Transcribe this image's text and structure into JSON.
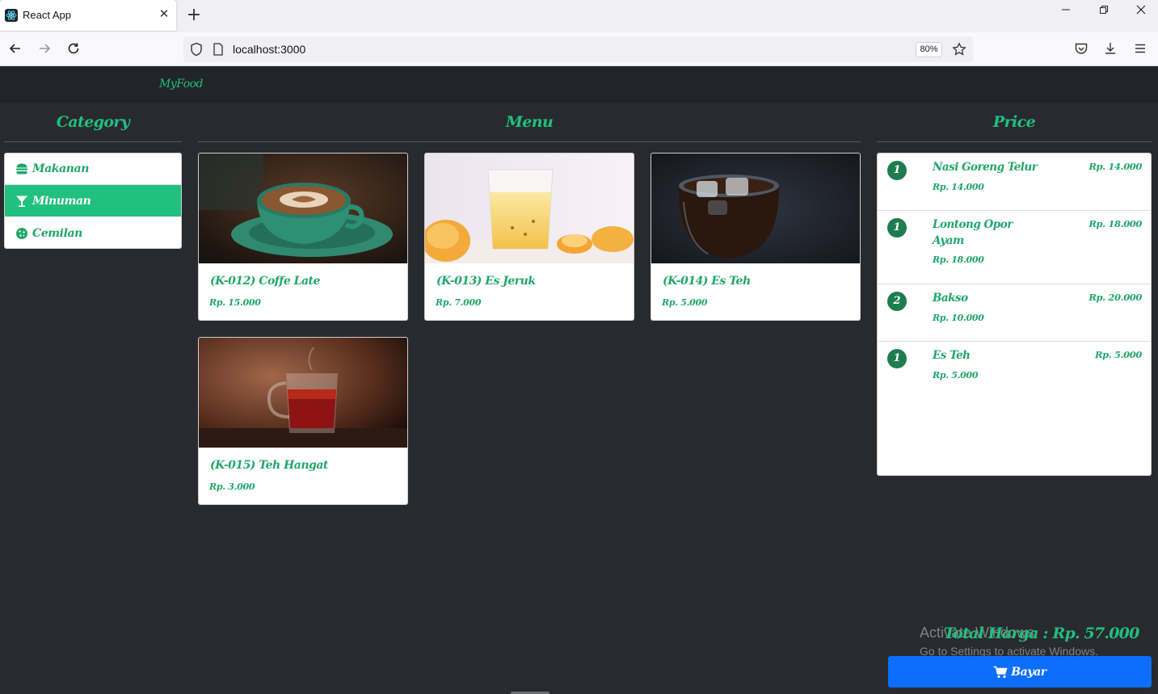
{
  "browser": {
    "tab_title": "React App",
    "tab_close": "✕",
    "new_tab": "+",
    "url": "localhost:3000",
    "zoom": "80%",
    "icons": [
      "react-favicon",
      "back-icon",
      "forward-icon",
      "reload-icon",
      "shield-icon",
      "page-icon",
      "bookmark-star-icon",
      "pocket-icon",
      "download-icon",
      "menu-icon",
      "minimize-icon",
      "restore-icon",
      "close-window-icon"
    ]
  },
  "app": {
    "brand": "MyFood",
    "columns": {
      "category": "Category",
      "menu": "Menu",
      "price": "Price"
    },
    "categories": [
      {
        "label": "Makanan",
        "icon": "burger-icon",
        "active": false
      },
      {
        "label": "Minuman",
        "icon": "cocktail-icon",
        "active": true
      },
      {
        "label": "Cemilan",
        "icon": "cookie-icon",
        "active": false
      }
    ],
    "menu_items": [
      {
        "title": "(K-012) Coffe Late",
        "price": "Rp. 15.000",
        "image": "latte-photo"
      },
      {
        "title": "(K-013) Es Jeruk",
        "price": "Rp. 7.000",
        "image": "orange-juice-photo"
      },
      {
        "title": "(K-014) Es Teh",
        "price": "Rp. 5.000",
        "image": "iced-tea-photo"
      },
      {
        "title": "(K-015) Teh Hangat",
        "price": "Rp. 3.000",
        "image": "hot-tea-photo"
      }
    ],
    "orders": [
      {
        "qty": "1",
        "name": "Nasi Goreng Telur",
        "unit_price": "Rp. 14.000",
        "total": "Rp. 14.000"
      },
      {
        "qty": "1",
        "name": "Lontong Opor Ayam",
        "unit_price": "Rp. 18.000",
        "total": "Rp. 18.000"
      },
      {
        "qty": "2",
        "name": "Bakso",
        "unit_price": "Rp. 10.000",
        "total": "Rp. 20.000"
      },
      {
        "qty": "1",
        "name": "Es Teh",
        "unit_price": "Rp. 5.000",
        "total": "Rp. 5.000"
      }
    ],
    "total_label": "Total Harga : Rp. 57.000",
    "pay_label": "Bayar"
  },
  "overlay": {
    "activate_title": "Activate Windows",
    "activate_sub": "Go to Settings to activate Windows."
  },
  "colors": {
    "accent": "#20c07e",
    "active_category": "#21c07e",
    "app_bg": "#282a2f",
    "navbar_bg": "#212429",
    "pay_button": "#0d6efd",
    "qty_badge": "#1d7d4e"
  }
}
